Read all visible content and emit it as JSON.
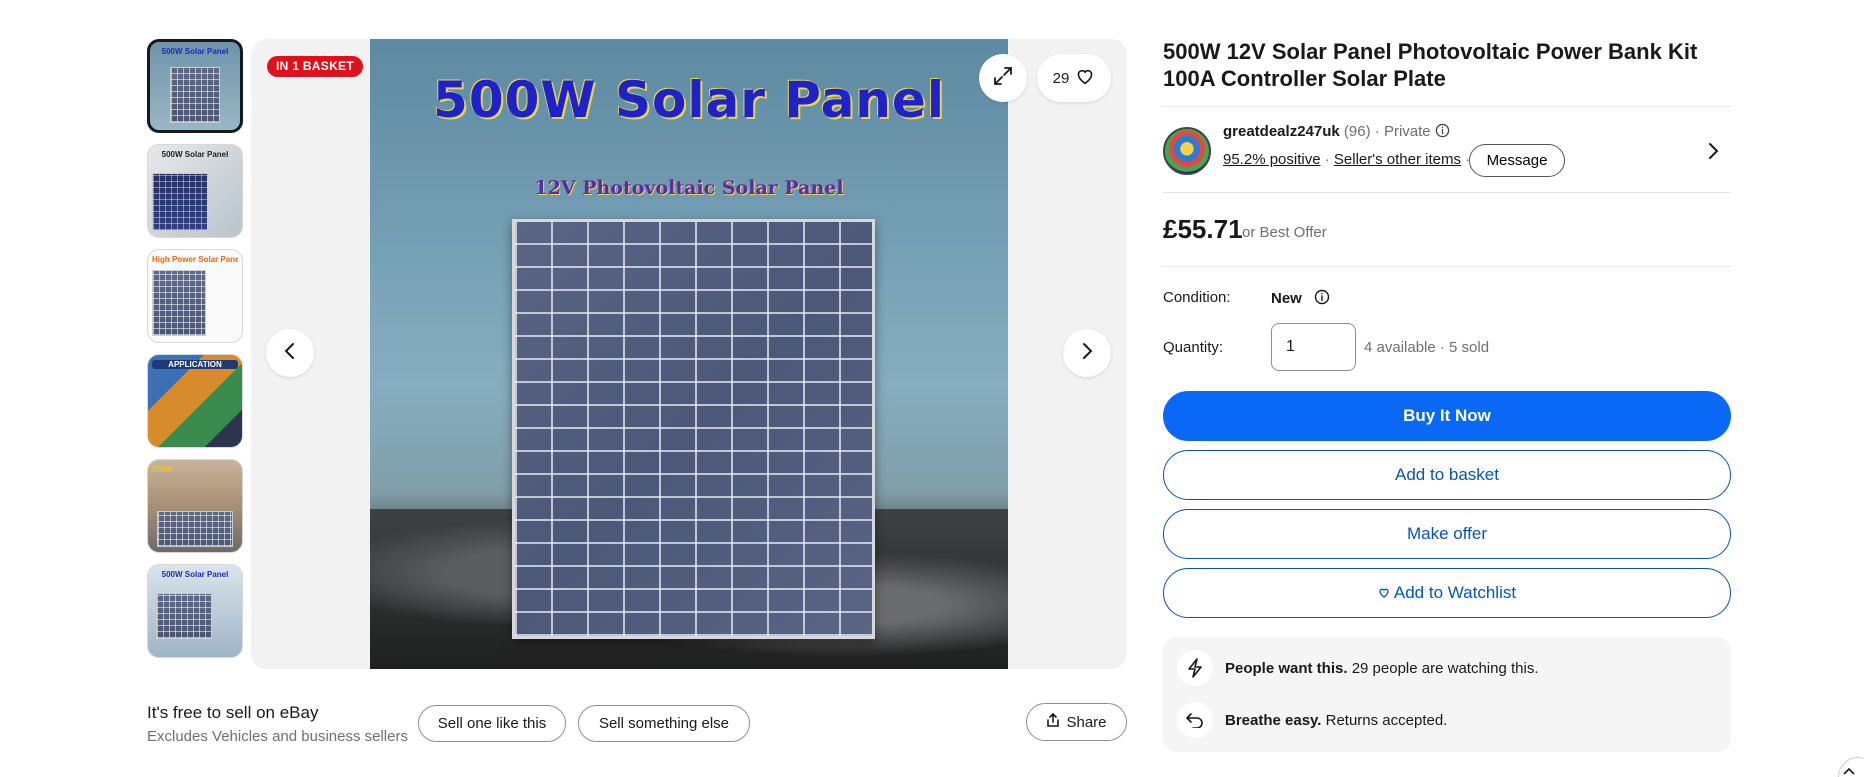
{
  "gallery": {
    "thumbnails": [
      {
        "caption": "500W Solar Panel"
      },
      {
        "caption": "500W Solar Panel"
      },
      {
        "caption": "High Power Solar Panel"
      },
      {
        "caption": "APPLICATION"
      },
      {
        "caption": "500W"
      },
      {
        "caption": "500W Solar Panel"
      }
    ],
    "hero_title": "500W Solar Panel",
    "hero_subtitle": "12V Photovoltaic Solar Panel",
    "badge": "IN 1 BASKET",
    "watch_count": "29",
    "icons": {
      "expand": "expand-icon",
      "heart": "heart-icon",
      "prev": "chevron-left-icon",
      "next": "chevron-right-icon"
    }
  },
  "sell": {
    "title": "It's free to sell on eBay",
    "subtitle": "Excludes Vehicles and business sellers",
    "sell_one_like_this": "Sell one like this",
    "sell_something_else": "Sell something else",
    "share": "Share"
  },
  "listing": {
    "title": "500W 12V Solar Panel Photovoltaic Power Bank Kit 100A Controller Solar Plate",
    "seller": {
      "name": "greatdealz247uk",
      "feedback_count": "(96)",
      "separator": "·",
      "type": "Private",
      "positive": "95.2% positive",
      "other_items": "Seller's other items",
      "message": "Message"
    },
    "price": "£55.71",
    "best_offer": "or Best Offer",
    "condition_label": "Condition:",
    "condition_value": "New",
    "quantity_label": "Quantity:",
    "quantity_value": "1",
    "availability": "4 available · 5 sold",
    "buy_now": "Buy It Now",
    "add_to_basket": "Add to basket",
    "make_offer": "Make offer",
    "add_to_watchlist": "Add to Watchlist",
    "signals": [
      {
        "bold": "People want this.",
        "text": " 29 people are watching this."
      },
      {
        "bold": "Breathe easy.",
        "text": " Returns accepted."
      }
    ]
  },
  "colors": {
    "primary_blue": "#0968f6",
    "link_blue": "#0654ba",
    "badge_red": "#e0101c",
    "text": "#191919",
    "muted": "#707070"
  }
}
